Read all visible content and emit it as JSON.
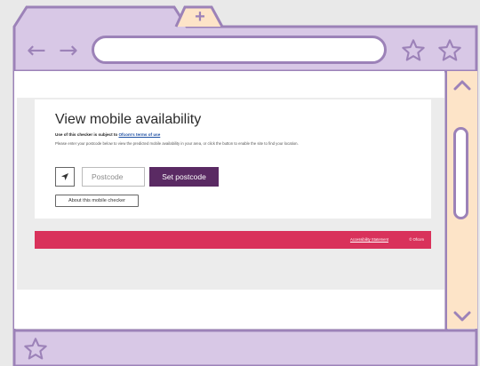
{
  "browser": {
    "new_tab_label": "+",
    "back_icon": "←",
    "forward_icon": "→",
    "url": "",
    "colors": {
      "frame": "#d8c8e6",
      "outline": "#9c82b8",
      "scrollbar": "#fde4c8"
    }
  },
  "page": {
    "title": "View mobile availability",
    "terms_prefix": "Use of this checker is subject to ",
    "terms_link": "Ofcom's terms of use",
    "description": "Please enter your postcode below to view the predicted mobile availability in your area, or click the button to enable the site to find your location.",
    "postcode_placeholder": "Postcode",
    "set_postcode_label": "Set postcode",
    "about_label": "About this mobile checker",
    "footer_link": "Accessibility Statement",
    "footer_copyright": "© Ofcom",
    "colors": {
      "primary": "#5a2a63",
      "footer": "#d9325b"
    }
  }
}
